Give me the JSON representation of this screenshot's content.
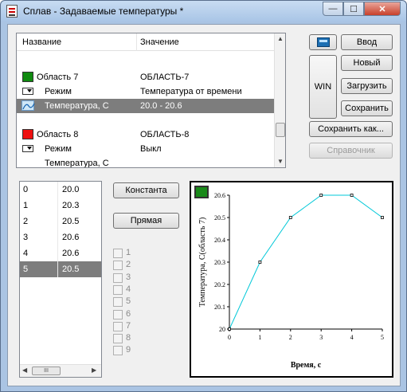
{
  "window": {
    "title": "Сплав - Задаваемые температуры *",
    "min_glyph": "—",
    "max_glyph": "☐",
    "close_glyph": "✕"
  },
  "props": {
    "header": {
      "name": "Название",
      "value": "Значение"
    },
    "rows": [
      {
        "kind": "area",
        "name": "Область 7",
        "value": "ОБЛАСТЬ-7",
        "color": "#0f8a0f"
      },
      {
        "kind": "mode",
        "name": "Режим",
        "value": "Температура от времени"
      },
      {
        "kind": "curve",
        "name": "Температура, С",
        "value": "20.0 - 20.6",
        "selected": true
      },
      {
        "kind": "area",
        "name": "Область 8",
        "value": "ОБЛАСТЬ-8",
        "color": "#ee1111"
      },
      {
        "kind": "mode",
        "name": "Режим",
        "value": "Выкл"
      },
      {
        "kind": "plain",
        "name": "Температура, С",
        "value": ""
      }
    ]
  },
  "buttons": {
    "enter": "Ввод",
    "new": "Новый",
    "load": "Загрузить",
    "save": "Сохранить",
    "save_as": "Сохранить как...",
    "reference": "Справочник",
    "win": "WIN",
    "constant": "Константа",
    "line": "Прямая"
  },
  "points": [
    {
      "i": "0",
      "v": "20.0"
    },
    {
      "i": "1",
      "v": "20.3"
    },
    {
      "i": "2",
      "v": "20.5"
    },
    {
      "i": "3",
      "v": "20.6"
    },
    {
      "i": "4",
      "v": "20.6"
    },
    {
      "i": "5",
      "v": "20.5",
      "selected": true
    }
  ],
  "hscroll_grip": "III",
  "checkboxes": [
    "1",
    "2",
    "3",
    "4",
    "5",
    "6",
    "7",
    "8",
    "9"
  ],
  "chart_data": {
    "type": "line",
    "x": [
      0,
      1,
      2,
      3,
      4,
      5
    ],
    "series": [
      {
        "values": [
          20.0,
          20.3,
          20.5,
          20.6,
          20.6,
          20.5
        ],
        "color": "#00c8d8"
      }
    ],
    "xlabel": "Время, с",
    "ylabel": "Температура, С(область 7)",
    "x_ticks": [
      "0",
      "1",
      "2",
      "3",
      "4",
      "5"
    ],
    "y_ticks": [
      "20",
      "20.1",
      "20.2",
      "20.3",
      "20.4",
      "20.5",
      "20.6"
    ],
    "xlim": [
      0,
      5
    ],
    "ylim": [
      20,
      20.6
    ],
    "grid": false,
    "legend_swatch_color": "#1a8a1a"
  }
}
